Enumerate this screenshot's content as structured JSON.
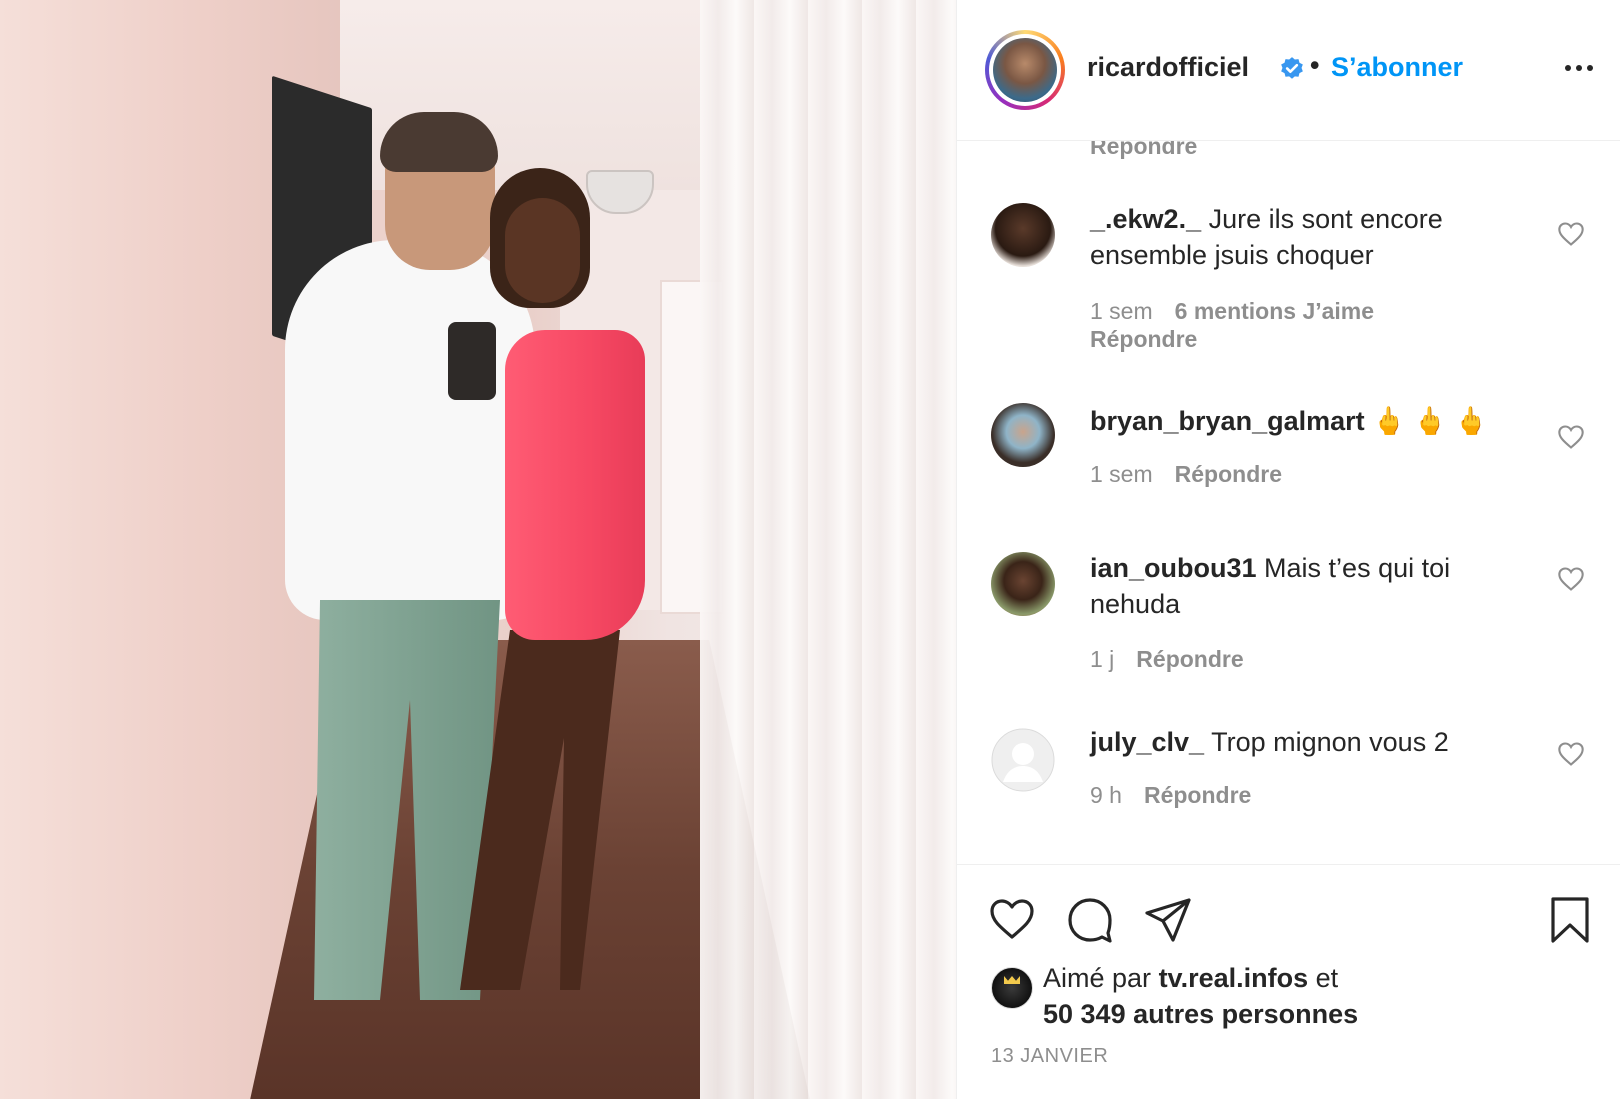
{
  "post": {
    "author": "ricardofficiel",
    "separator": "•",
    "follow_label": "S’abonner",
    "verified_icon": "verified-badge-icon",
    "more_icon": "more-options-icon"
  },
  "comments": {
    "reply_label": "Répondre",
    "items": [
      {
        "user": "_.ekw2._",
        "text": "Jure ils sont encore ensemble jsuis choquer",
        "time": "1 sem",
        "likes": "6 mentions J’aime",
        "reply": "Répondre"
      },
      {
        "user": "bryan_bryan_galmart",
        "text": "🖕 🖕 🖕",
        "time": "1 sem",
        "reply": "Répondre"
      },
      {
        "user": "ian_oubou31",
        "text": "Mais t’es qui toi nehuda",
        "time": "1 j",
        "reply": "Répondre"
      },
      {
        "user": "july_clv_",
        "text": "Trop mignon vous 2",
        "time": "9 h",
        "reply": "Répondre"
      }
    ]
  },
  "footer": {
    "liked_by_prefix": "Aimé par",
    "liked_by_user": "tv.real.infos",
    "liked_by_and": "et",
    "others": "50 349 autres personnes",
    "date": "13 JANVIER",
    "icons": [
      "heart-icon",
      "comment-icon",
      "share-icon",
      "bookmark-icon"
    ]
  },
  "colors": {
    "link_blue": "#0095f6",
    "text": "#262626",
    "muted": "#8e8e8e"
  }
}
